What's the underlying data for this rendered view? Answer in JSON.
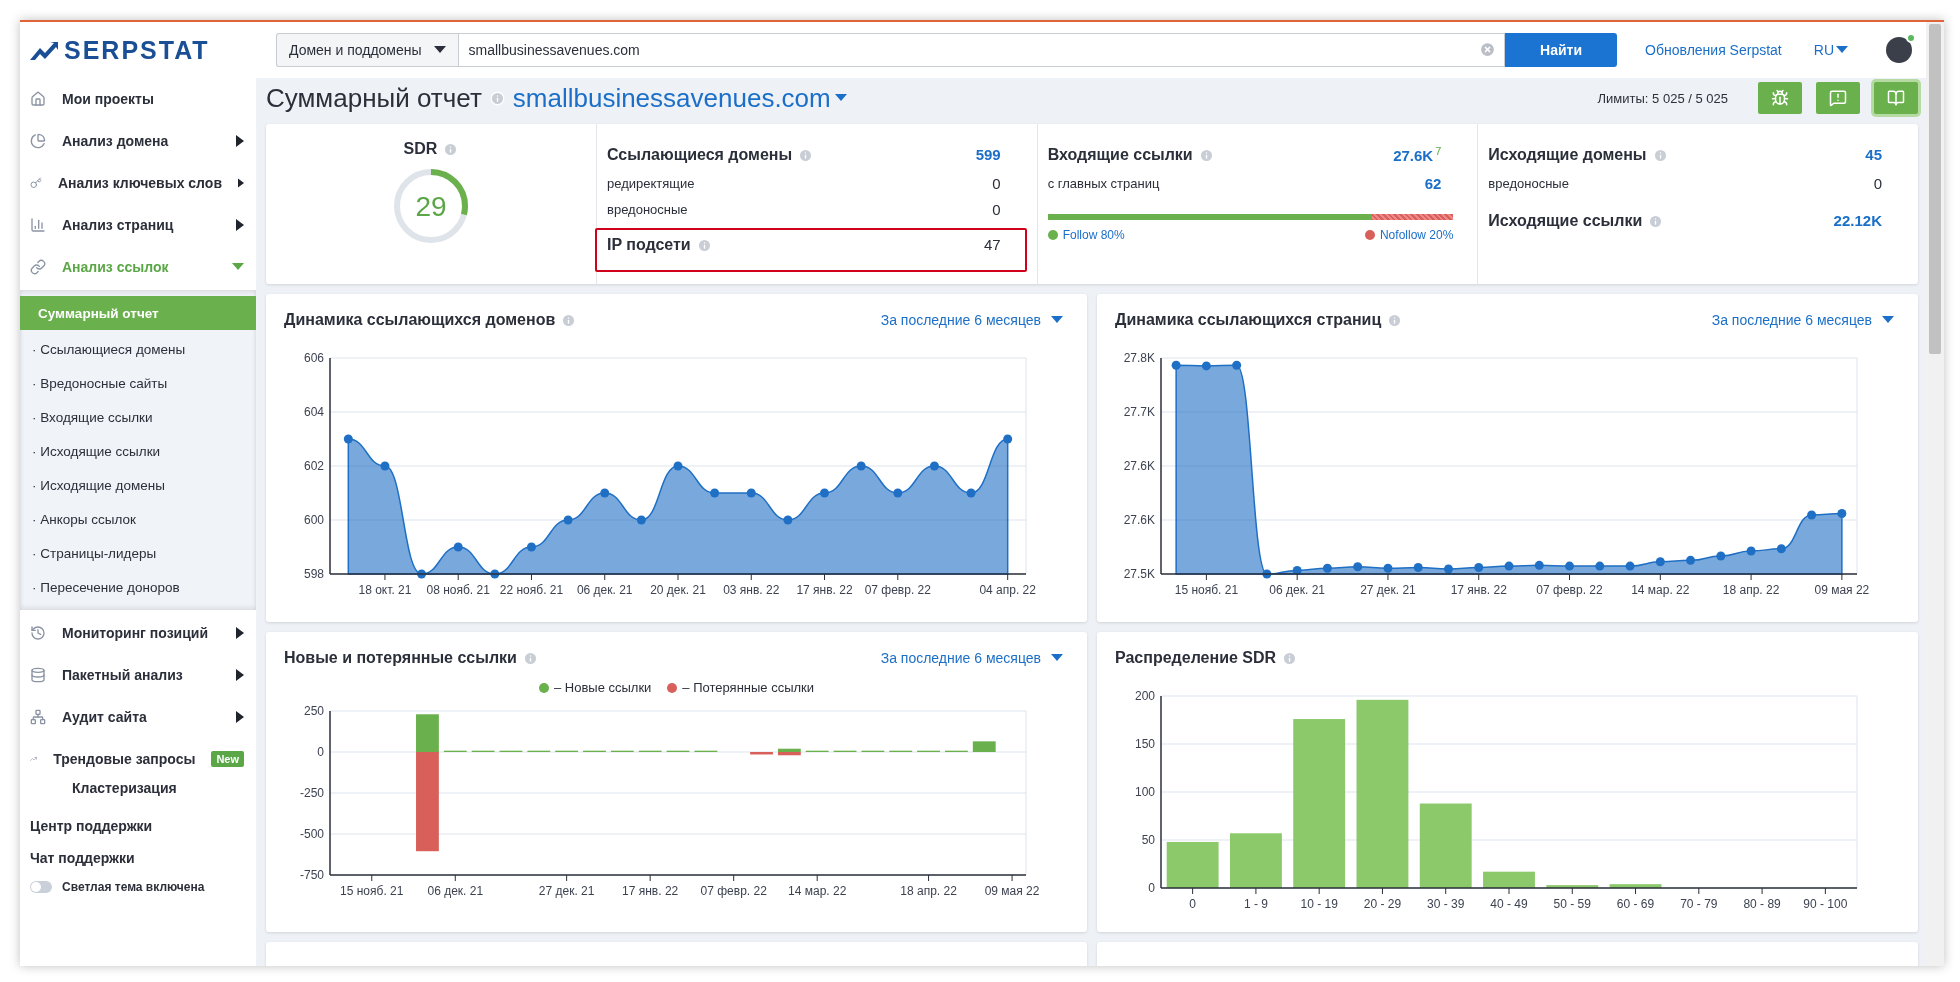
{
  "header": {
    "logo": "SERPSTAT",
    "search_scope": "Домен и поддомены",
    "search_value": "smallbusinessavenues.com",
    "search_button": "Найти",
    "updates_link": "Обновления Serpstat",
    "language": "RU"
  },
  "sidebar": {
    "items": [
      {
        "label": "Мои проекты"
      },
      {
        "label": "Анализ домена",
        "expanded": false
      },
      {
        "label": "Анализ ключевых слов",
        "expanded": false
      },
      {
        "label": "Анализ страниц",
        "expanded": false
      },
      {
        "label": "Анализ ссылок",
        "expanded": true,
        "children": [
          {
            "label": "Суммарный отчет",
            "selected": true
          },
          {
            "label": "· Ссылающиеся домены",
            "selected": false
          },
          {
            "label": "· Вредоносные сайты",
            "selected": false
          },
          {
            "label": "· Входящие ссылки",
            "selected": false
          },
          {
            "label": "· Исходящие ссылки",
            "selected": false
          },
          {
            "label": "· Исходящие домены",
            "selected": false
          },
          {
            "label": "· Анкоры ссылок",
            "selected": false
          },
          {
            "label": "· Страницы-лидеры",
            "selected": false
          },
          {
            "label": "· Пересечение доноров",
            "selected": false
          }
        ]
      },
      {
        "label": "Мониторинг позиций",
        "expanded": false
      },
      {
        "label": "Пакетный анализ",
        "expanded": false
      },
      {
        "label": "Аудит сайта",
        "expanded": false
      },
      {
        "label": "Трендовые запросы",
        "badge": "New"
      },
      {
        "label": "Кластеризация"
      }
    ],
    "footer_links": [
      "Центр поддержки",
      "Чат поддержки"
    ],
    "theme_toggle": {
      "label": "Светлая тема включена",
      "on": false
    }
  },
  "page": {
    "title": "Суммарный отчет",
    "domain": "smallbusinessavenues.com",
    "limits": "Лимиты: 5 025 / 5 025",
    "actions": [
      {
        "selected": false
      },
      {
        "selected": false
      },
      {
        "selected": true
      }
    ]
  },
  "summary": {
    "sdr": {
      "label": "SDR",
      "value": "29",
      "level": 0.29
    },
    "columns": [
      {
        "rows": [
          {
            "kind": "heading",
            "label": "Ссылающиеся домены",
            "value": "599",
            "linked": true
          },
          {
            "kind": "sub",
            "label": "редиректящие",
            "value": "0",
            "linked": false
          },
          {
            "kind": "sub",
            "label": "вредоносные",
            "value": "0",
            "linked": false
          },
          {
            "kind": "heading",
            "label": "IP подсети",
            "value": "47",
            "linked": false,
            "highlighted": true
          }
        ]
      },
      {
        "rows": [
          {
            "kind": "heading",
            "label": "Входящие ссылки",
            "value": "27.6K",
            "delta": "7",
            "linked": true
          },
          {
            "kind": "sub",
            "label": "с главных страниц",
            "value": "62",
            "linked": true
          }
        ],
        "follow": {
          "level": 0.8,
          "follow_label": "Follow 80%",
          "nofollow_label": "Nofollow 20%"
        }
      },
      {
        "rows": [
          {
            "kind": "heading",
            "label": "Исходящие домены",
            "value": "45",
            "linked": true
          },
          {
            "kind": "sub",
            "label": "вредоносные",
            "value": "0",
            "linked": false
          },
          {
            "kind": "heading",
            "label": "Исходящие ссылки",
            "value": "22.12K",
            "linked": true
          }
        ]
      }
    ]
  },
  "charts": [
    {
      "title": "Динамика ссылающихся доменов",
      "period": "За последние 6 месяцев",
      "chart_data": {
        "type": "area",
        "grid": true,
        "categories": [
          null,
          "18 окт. 21",
          null,
          "08 нояб. 21",
          null,
          "22 нояб. 21",
          null,
          "06 дек. 21",
          null,
          "20 дек. 21",
          null,
          "03 янв. 22",
          null,
          "17 янв. 22",
          null,
          "07 февр. 22",
          null,
          null,
          "04 апр. 22"
        ],
        "series": [
          {
            "color": "#1f6fc5",
            "values": [
              603,
              602,
              598,
              599,
              598,
              599,
              600,
              601,
              600,
              602,
              601,
              601,
              600,
              601,
              602,
              601,
              602,
              601,
              603
            ]
          }
        ],
        "ylim": [
          598,
          606
        ],
        "yticks": [
          598,
          600,
          602,
          604,
          606
        ]
      }
    },
    {
      "title": "Динамика ссылающихся страниц",
      "period": "За последние 6 месяцев",
      "chart_data": {
        "type": "area",
        "grid": true,
        "categories": [
          null,
          "15 нояб. 21",
          null,
          null,
          "06 дек. 21",
          null,
          null,
          "27 дек. 21",
          null,
          null,
          "17 янв. 22",
          null,
          null,
          "07 февр. 22",
          null,
          null,
          "14 мар. 22",
          null,
          null,
          "18 апр. 22",
          null,
          null,
          "09 мая 22"
        ],
        "series": [
          {
            "color": "#1f6fc5",
            "values": [
              27790,
              27789,
              27790,
              27500,
              27505,
              27508,
              27510,
              27508,
              27509,
              27507,
              27509,
              27511,
              27512,
              27511,
              27511,
              27511,
              27517,
              27519,
              27525,
              27532,
              27535,
              27582,
              27584
            ]
          }
        ],
        "ylim": [
          27500,
          27800
        ],
        "yticks": [
          {
            "value": 27500,
            "label": "27.5K"
          },
          {
            "value": 27575,
            "label": "27.6K"
          },
          {
            "value": 27650,
            "label": "27.6K"
          },
          {
            "value": 27725,
            "label": "27.7K"
          },
          {
            "value": 27800,
            "label": "27.8K"
          }
        ]
      }
    },
    {
      "title": "Новые и потерянные ссылки",
      "period": "За последние 6 месяцев",
      "chart_data": {
        "type": "bar",
        "stacked": true,
        "grid": true,
        "categories": [
          null,
          "15 нояб. 21",
          null,
          null,
          "06 дек. 21",
          null,
          null,
          null,
          "27 дек. 21",
          null,
          null,
          "17 янв. 22",
          null,
          null,
          "07 февр. 22",
          null,
          null,
          "14 мар. 22",
          null,
          null,
          null,
          "18 апр. 22",
          null,
          null,
          "09 мая 22"
        ],
        "series": [
          {
            "name": "– Новые ссылки",
            "color": "#6ab04c",
            "values": [
              0,
              0,
              0,
              230,
              8,
              8,
              8,
              8,
              8,
              8,
              8,
              8,
              8,
              8,
              0,
              0,
              20,
              8,
              8,
              8,
              8,
              8,
              8,
              65,
              0
            ]
          },
          {
            "name": "– Потерянные ссылки",
            "color": "#d9605a",
            "values": [
              0,
              0,
              0,
              -605,
              0,
              0,
              0,
              0,
              0,
              0,
              0,
              0,
              0,
              0,
              0,
              -15,
              -20,
              0,
              0,
              0,
              0,
              0,
              0,
              0,
              0
            ]
          }
        ],
        "ylim": [
          -750,
          250
        ],
        "yticks": [
          -750,
          -500,
          -250,
          0,
          250
        ]
      }
    },
    {
      "title": "Распределение SDR",
      "chart_data": {
        "type": "bar",
        "grid": true,
        "categories": [
          "0",
          "1 - 9",
          "10 - 19",
          "20 - 29",
          "30 - 39",
          "40 - 49",
          "50 - 59",
          "60 - 69",
          "70 - 79",
          "80 - 89",
          "90 - 100"
        ],
        "series": [
          {
            "color": "#8cc96a",
            "values": [
              48,
              57,
              176,
              196,
              88,
              17,
              3,
              4,
              0,
              0,
              0
            ]
          }
        ],
        "ylim": [
          0,
          200
        ],
        "yticks": [
          0,
          50,
          100,
          150,
          200
        ]
      }
    }
  ]
}
